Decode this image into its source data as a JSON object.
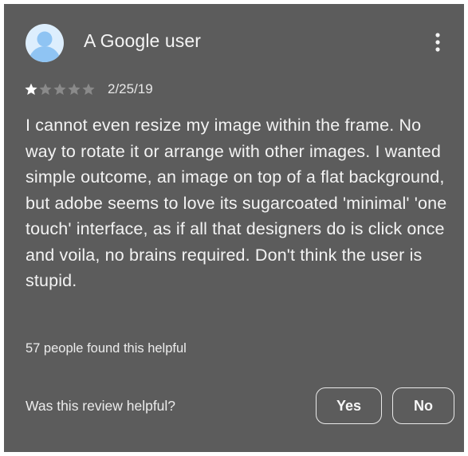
{
  "review": {
    "reviewer_name": "A Google user",
    "avatar_icon": "person-icon",
    "more_icon": "more-vert-icon",
    "rating": 1,
    "rating_max": 5,
    "date": "2/25/19",
    "text": "I cannot even resize my image within the frame. No way to rotate it or arrange with other images. I wanted simple outcome, an image on top of a flat background, but adobe seems to love its sugarcoated 'minimal' 'one touch' interface, as if all that designers do is click once and voila, no brains required. Don't think the user is stupid.",
    "helpful_count_text": "57 people found this helpful"
  },
  "feedback": {
    "question": "Was this review helpful?",
    "yes_label": "Yes",
    "no_label": "No"
  },
  "colors": {
    "card_background": "#5c5c5c",
    "text": "#f3f3f3",
    "star_filled": "#ffffff",
    "star_empty": "#8a8a8a",
    "avatar_background": "#ddeefd",
    "avatar_figure": "#8fc4f3"
  }
}
